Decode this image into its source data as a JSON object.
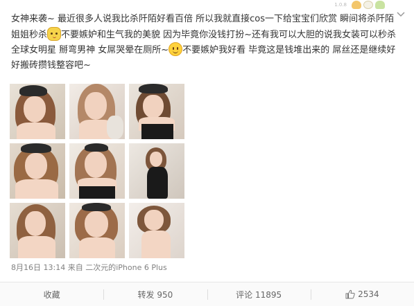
{
  "post": {
    "text_part1": "女神来袭~ 最近很多人说我比杀阡陌好看百倍 所以我就直接cos一下给宝宝们欣赏 瞬间将杀阡陌姐姐秒杀",
    "emoji1": "cat-face-emoji",
    "text_part2": "不要嫉妒和生气我的美貌 因为毕竟你没钱打扮~还有我可以大胆的说我女装可以秒杀全球女明星 掰弯男神 女屌哭晕在厕所~",
    "emoji2": "smile-emoji",
    "text_part3": "不要嫉妒我好看 毕竟这是钱堆出来的 屌丝还是继续好好搬砖攒钱整容吧~"
  },
  "photos": [
    {
      "id": "photo-1"
    },
    {
      "id": "photo-2"
    },
    {
      "id": "photo-3"
    },
    {
      "id": "photo-4"
    },
    {
      "id": "photo-5"
    },
    {
      "id": "photo-6"
    },
    {
      "id": "photo-7"
    },
    {
      "id": "photo-8"
    },
    {
      "id": "photo-9"
    }
  ],
  "meta": {
    "date": "8月16日 13:14",
    "from_label": "来自",
    "source": "二次元的iPhone 6 Plus"
  },
  "actions": {
    "favorite": "收藏",
    "repost": "转发 950",
    "comment": "评论 11895",
    "like": "2534"
  },
  "top_decoration": {
    "mini_text": "1.0.8",
    "icons": [
      "bread-icon",
      "rice-icon",
      "cake-icon"
    ]
  },
  "colors": {
    "text": "#333333",
    "meta": "#808080",
    "action_text": "#666666",
    "action_bar_bg": "#fafafa",
    "divider": "#e6e6e6"
  }
}
